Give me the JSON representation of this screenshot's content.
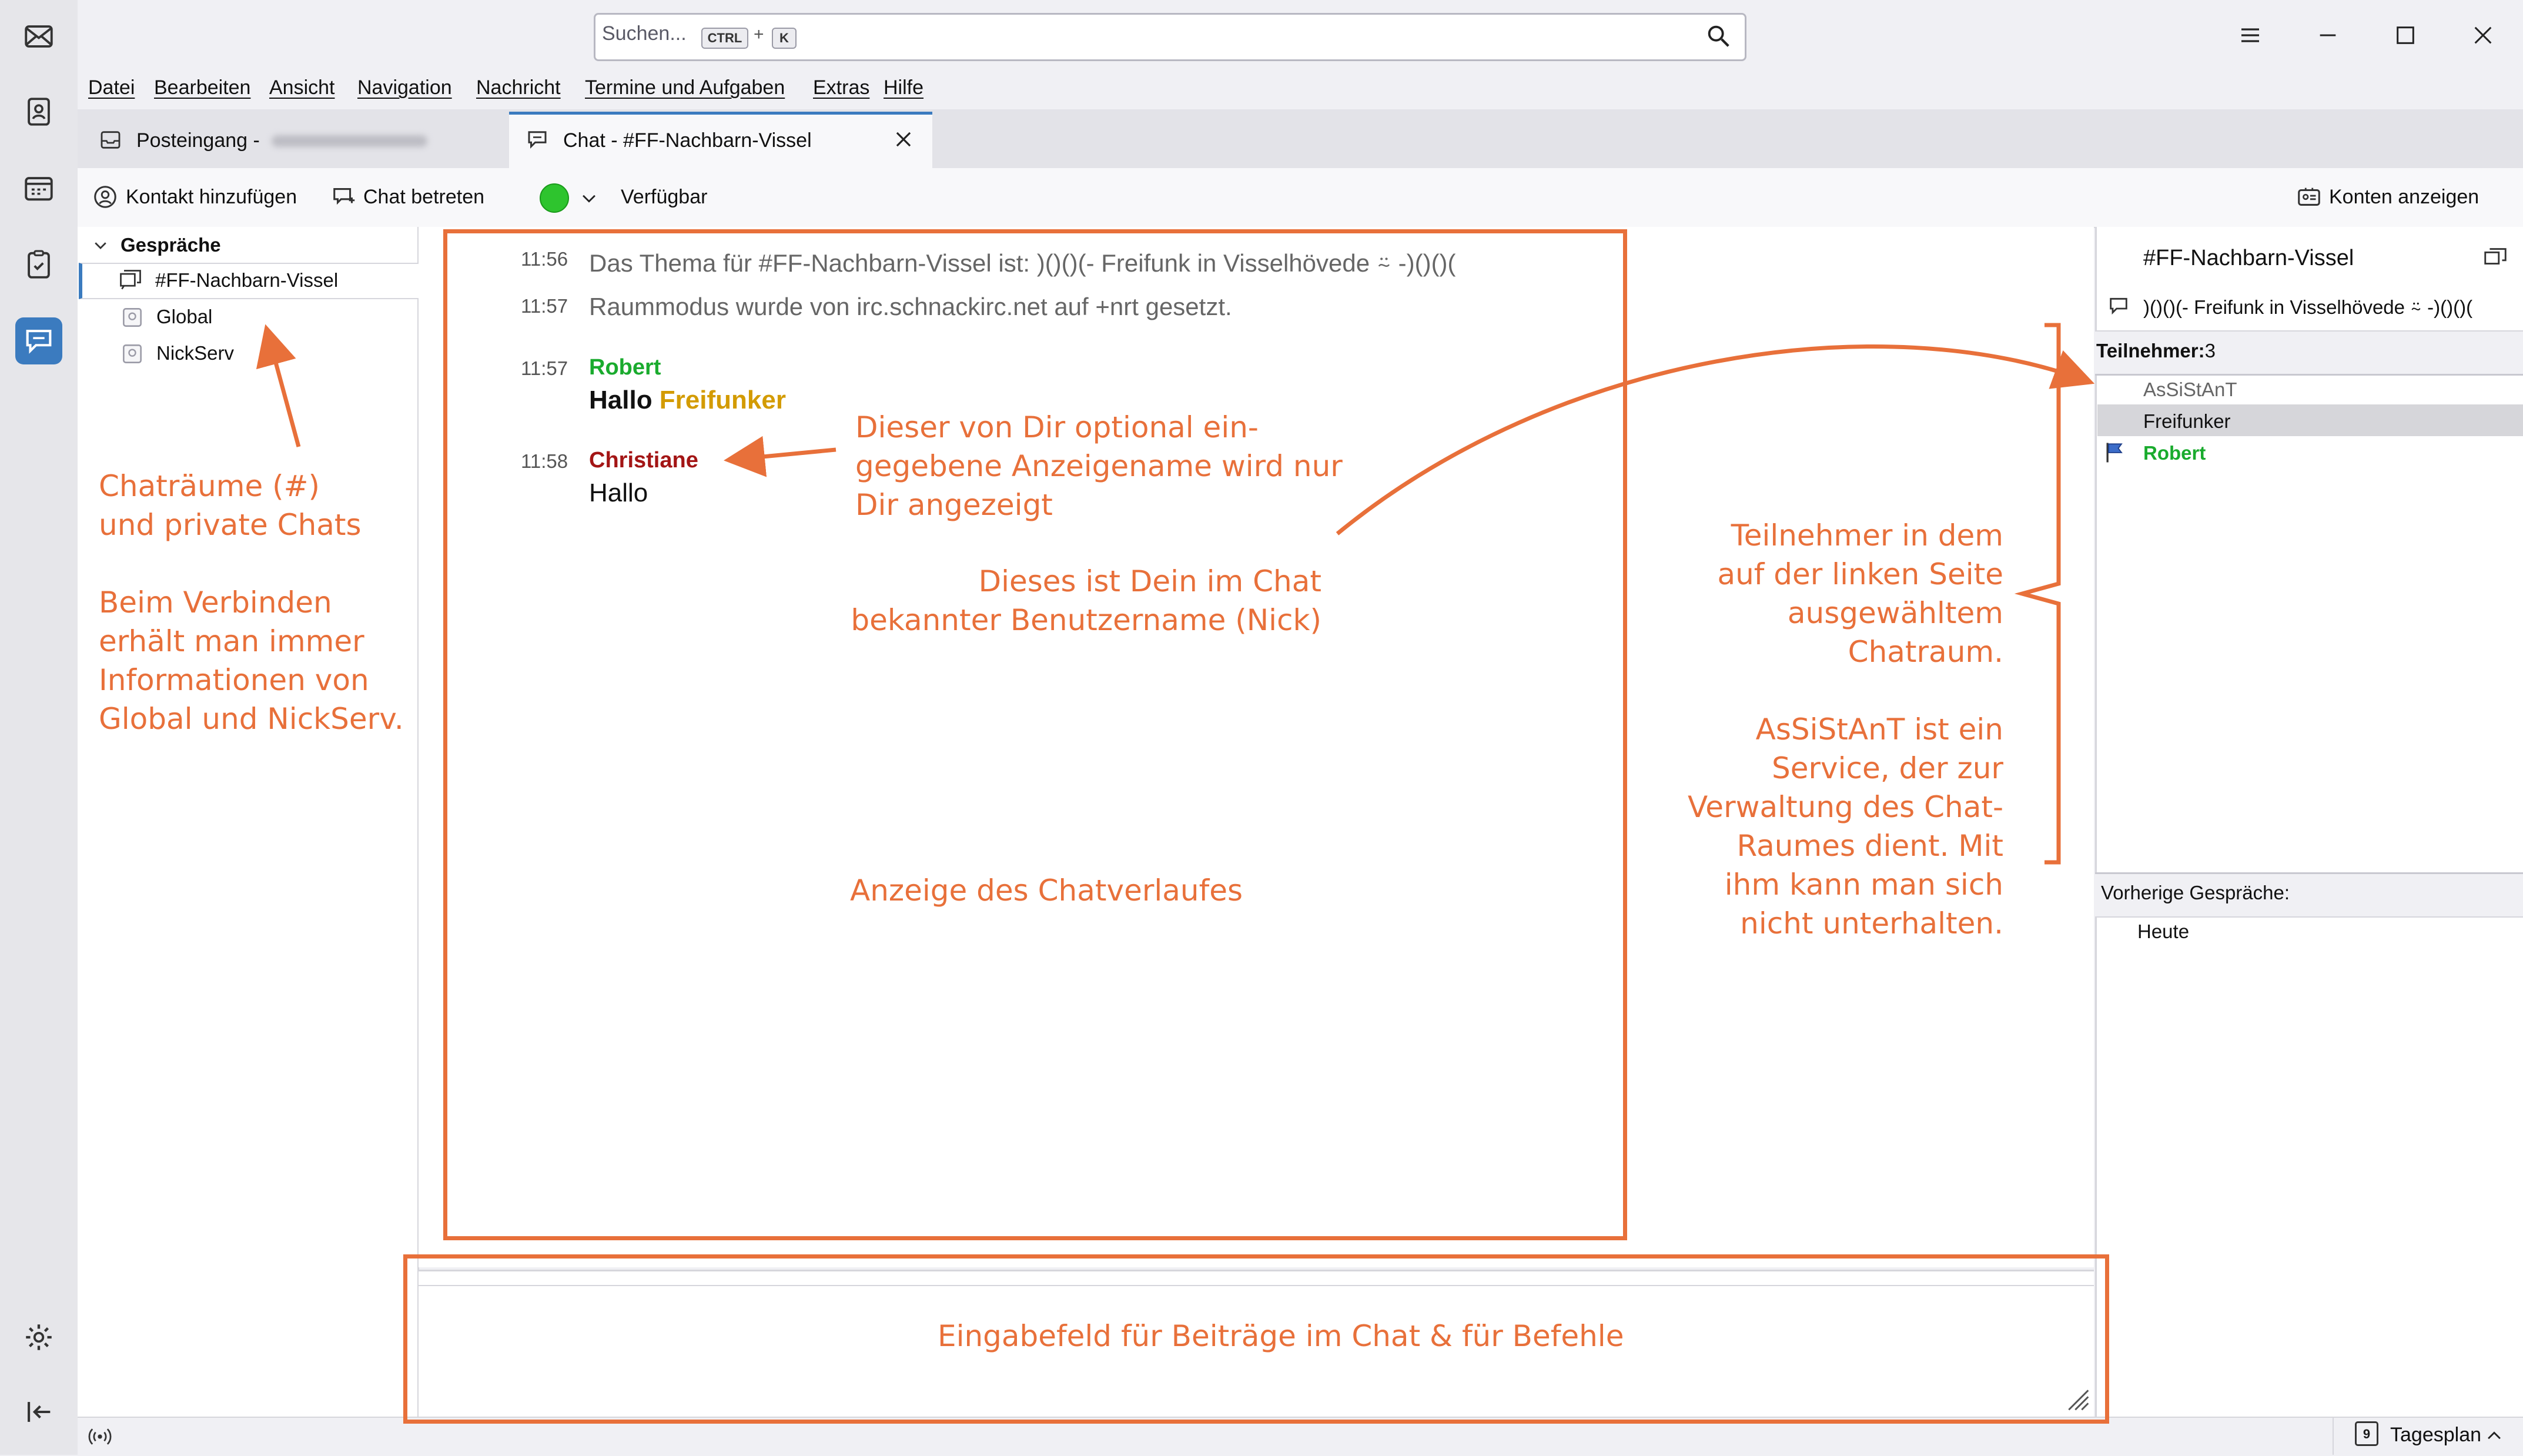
{
  "search": {
    "placeholder": "Suchen...",
    "kbd1": "CTRL",
    "plus": "+",
    "kbd2": "K"
  },
  "menu": [
    "Datei",
    "Bearbeiten",
    "Ansicht",
    "Navigation",
    "Nachricht",
    "Termine und Aufgaben",
    "Extras",
    "Hilfe"
  ],
  "tabs": [
    {
      "label": "Posteingang -"
    },
    {
      "label": "Chat - #FF-Nachbarn-Vissel"
    }
  ],
  "toolbar": {
    "add_contact": "Kontakt hinzufügen",
    "join_chat": "Chat betreten",
    "status": "Verfügbar",
    "show_accounts": "Konten anzeigen",
    "status_color": "#2ec42e"
  },
  "conversations": {
    "header": "Gespräche",
    "items": [
      "#FF-Nachbarn-Vissel",
      "Global",
      "NickServ"
    ]
  },
  "chat": {
    "messages": [
      {
        "time": "11:56",
        "text": "Das Thema für #FF-Nachbarn-Vissel ist: )()()(- Freifunk in Visselhövede ⍨ -)()()("
      },
      {
        "time": "11:57",
        "text": "Raummodus wurde von irc.schnackirc.net auf +nrt gesetzt."
      },
      {
        "time": "11:57",
        "nick": "Robert",
        "nick_color": "#1aab2e",
        "text_a": "Hallo ",
        "text_b": "Freifunker",
        "highlight_color": "#d39b00"
      },
      {
        "time": "11:58",
        "nick": "Christiane",
        "nick_color": "#a31515",
        "text": "Hallo"
      }
    ]
  },
  "room": {
    "name": "#FF-Nachbarn-Vissel",
    "topic": ")()()(- Freifunk in Visselhövede ⍨ -)()()(",
    "participants_label": "Teilnehmer:",
    "participants_count": "3",
    "participants": [
      {
        "name": "AsSiStAnT",
        "color": "#666666"
      },
      {
        "name": "Freifunker",
        "color": "#111111"
      },
      {
        "name": "Robert",
        "color": "#1aab2e"
      }
    ],
    "previous_label": "Vorherige Gespräche:",
    "previous_items": [
      "Heute"
    ]
  },
  "statusbar": {
    "today_pane": "Tagesplan",
    "day": "9"
  },
  "annotations": {
    "chatrooms": [
      "Chaträume (#)",
      "und private Chats",
      "",
      "Beim Verbinden",
      "erhält man immer",
      "Informationen von",
      "Global und NickServ."
    ],
    "display_name": [
      "Dieser von Dir optional ein-",
      "gegebene Anzeigename wird nur",
      "Dir angezeigt"
    ],
    "nick": [
      "Dieses ist Dein im Chat",
      "bekannter Benutzername (Nick)"
    ],
    "history": "Anzeige des Chatverlaufes",
    "participants": [
      "Teilnehmer in dem",
      "auf der linken Seite",
      "ausgewähltem",
      "Chatraum.",
      "",
      "AsSiStAnT ist ein",
      "Service, der zur",
      "Verwaltung des Chat-",
      "Raumes dient. Mit",
      "ihm kann man sich",
      "nicht unterhalten."
    ],
    "input": "Eingabefeld für Beiträge im Chat & für Befehle"
  }
}
